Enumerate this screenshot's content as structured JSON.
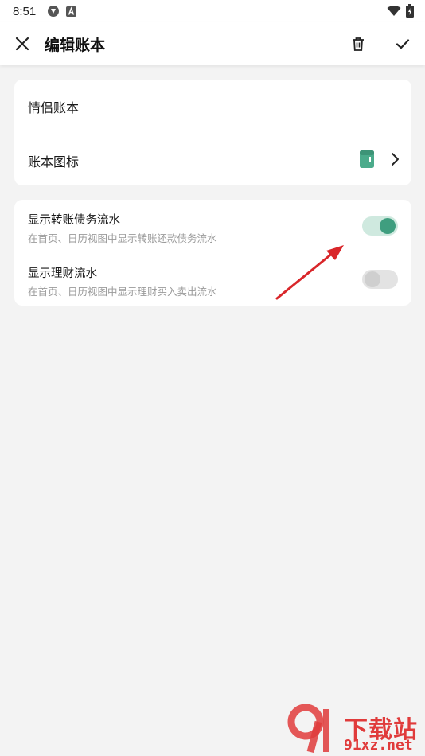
{
  "status_bar": {
    "time": "8:51"
  },
  "app_bar": {
    "title": "编辑账本",
    "icons": [
      "close-icon",
      "trash-icon",
      "check-icon"
    ]
  },
  "book_card": {
    "name": "情侣账本",
    "icon_row_label": "账本图标",
    "book_icon_color": "#4bab8b"
  },
  "options_card": {
    "items": [
      {
        "title": "显示转账债务流水",
        "subtitle": "在首页、日历视图中显示转账还款债务流水",
        "enabled": true
      },
      {
        "title": "显示理财流水",
        "subtitle": "在首页、日历视图中显示理财买入卖出流水",
        "enabled": false
      }
    ]
  },
  "colors": {
    "accent": "#3f9e7f",
    "accent_track": "#cfe9df",
    "background": "#f3f3f3",
    "annotation_arrow": "#d9262a"
  },
  "watermark": {
    "line1": "下载站",
    "line2": "91xz.net"
  }
}
